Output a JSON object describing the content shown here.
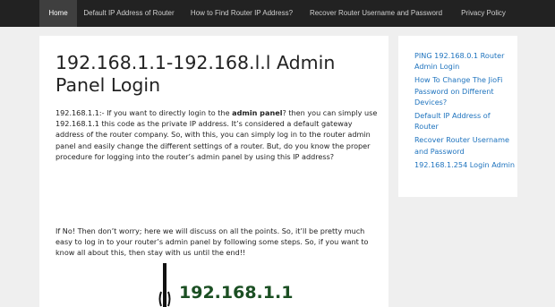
{
  "nav": {
    "items": [
      {
        "label": "Home",
        "active": true
      },
      {
        "label": "Default IP Address of Router",
        "active": false
      },
      {
        "label": "How to Find Router IP Address?",
        "active": false
      },
      {
        "label": "Recover Router Username and Password",
        "active": false
      },
      {
        "label": "Privacy Policy",
        "active": false
      }
    ]
  },
  "article": {
    "title": "192.168.1.1-192.168.l.l Admin Panel Login",
    "p1_a": "192.168.1.1:- If you want to directly login to the ",
    "p1_bold": "admin panel",
    "p1_b": "? then you can simply use 192.168.1.1 this code as the private IP address. It’s considered a default gateway address of the router company. So, with this, you can simply log in to the router admin panel and easily change the different settings of a router. But, do you know the proper procedure for logging into the router’s admin panel by using this IP address?",
    "p2": "If No! Then don’t worry; here we will discuss on all the points. So, it’ll be pretty much easy to log in to your router’s admin panel by following some steps. So, if you want to know all about this, then stay with us until the end!!",
    "image_text": "192.168.1.1"
  },
  "sidebar": {
    "links": [
      "PING 192.168.0.1 Router Admin Login",
      "How To Change The JioFi Password on Different Devices?",
      "Default IP Address of Router",
      "Recover Router Username and Password",
      "192.168.1.254 Login Admin"
    ]
  },
  "colors": {
    "nav_bg": "#222222",
    "nav_active_bg": "#3f3f3f",
    "link": "#1e73be",
    "page_bg": "#efefef",
    "router_text": "#1b4f23"
  }
}
